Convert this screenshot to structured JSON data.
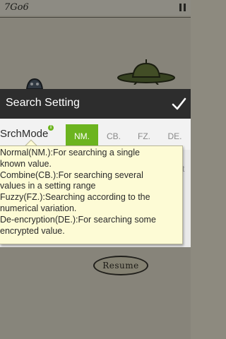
{
  "game": {
    "title": "7Go6",
    "resume_label": "Resume"
  },
  "dialog": {
    "title": "Search Setting",
    "confirm_icon": "check-icon"
  },
  "search_mode": {
    "label": "SrchMode",
    "info_icon": "i",
    "tabs": [
      {
        "label": "NM.",
        "selected": true
      },
      {
        "label": "CB.",
        "selected": false
      },
      {
        "label": "FZ.",
        "selected": false
      },
      {
        "label": "DE.",
        "selected": false
      }
    ],
    "hidden_edge_text": "t"
  },
  "tooltip": {
    "lines": [
      "Normal(NM.):For searching a single",
      "known value.",
      "Combine(CB.):For searching several",
      "values in a setting range",
      "Fuzzy(FZ.):Searching according to the",
      "numerical variation.",
      "De-encryption(DE.):For searching some",
      "encrypted value."
    ]
  },
  "colors": {
    "accent": "#6cb41f",
    "header_bg": "#2d2d2d",
    "tooltip_bg": "#fdfbd5"
  }
}
